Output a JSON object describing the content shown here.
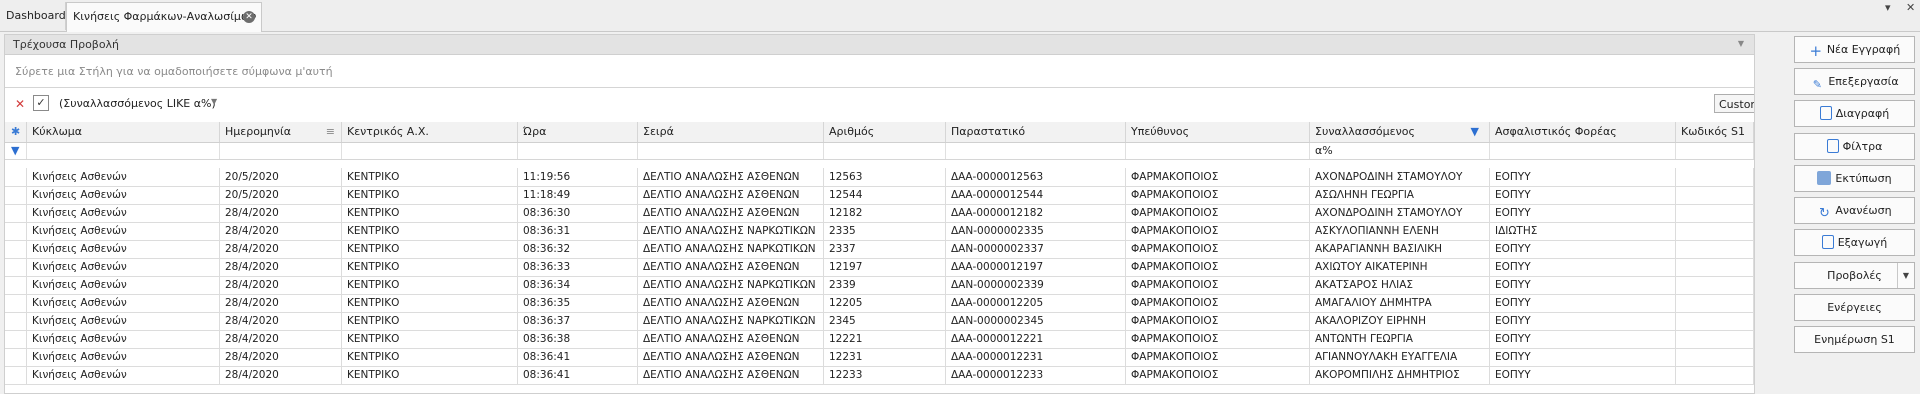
{
  "tabs": [
    {
      "label": "Dashboard"
    },
    {
      "label": "Κινήσεις Φαρμάκων-Αναλωσίμων"
    }
  ],
  "view_header": "Τρέχουσα Προβολή",
  "group_placeholder": "Σύρετε μια Στήλη για να ομαδοποιήσετε σύμφωνα μ'αυτή",
  "filter": {
    "text": "(Συναλλασσόμενος LIKE α%)",
    "checked": "✓",
    "customize_label": "Customize..."
  },
  "columns": [
    "Κύκλωμα",
    "Ημερομηνία",
    "Κεντρικός Α.Χ.",
    "Ώρα",
    "Σειρά",
    "Αριθμός",
    "Παραστατικό",
    "Υπεύθυνος",
    "Συναλλασσόμενος",
    "Ασφαλιστικός Φορέας",
    "Κωδικός S1"
  ],
  "filter_row_value": "α%",
  "rows": [
    [
      "Κινήσεις Ασθενών",
      "20/5/2020",
      "ΚΕΝΤΡΙΚΟ",
      "11:19:56",
      "ΔΕΛΤΙΟ ΑΝΑΛΩΣΗΣ ΑΣΘΕΝΩΝ",
      "12563",
      "ΔΑΑ-0000012563",
      "ΦΑΡΜΑΚΟΠΟΙΟΣ",
      "ΑΧΟΝΔΡΟΔΙΝΗ ΣΤΑΜΟΥΛΟΥ",
      "ΕΟΠΥΥ",
      ""
    ],
    [
      "Κινήσεις Ασθενών",
      "20/5/2020",
      "ΚΕΝΤΡΙΚΟ",
      "11:18:49",
      "ΔΕΛΤΙΟ ΑΝΑΛΩΣΗΣ ΑΣΘΕΝΩΝ",
      "12544",
      "ΔΑΑ-0000012544",
      "ΦΑΡΜΑΚΟΠΟΙΟΣ",
      "ΑΣΩΛΗΝΗ ΓΕΩΡΓΙΑ",
      "ΕΟΠΥΥ",
      ""
    ],
    [
      "Κινήσεις Ασθενών",
      "28/4/2020",
      "ΚΕΝΤΡΙΚΟ",
      "08:36:30",
      "ΔΕΛΤΙΟ ΑΝΑΛΩΣΗΣ ΑΣΘΕΝΩΝ",
      "12182",
      "ΔΑΑ-0000012182",
      "ΦΑΡΜΑΚΟΠΟΙΟΣ",
      "ΑΧΟΝΔΡΟΔΙΝΗ ΣΤΑΜΟΥΛΟΥ",
      "ΕΟΠΥΥ",
      ""
    ],
    [
      "Κινήσεις Ασθενών",
      "28/4/2020",
      "ΚΕΝΤΡΙΚΟ",
      "08:36:31",
      "ΔΕΛΤΙΟ ΑΝΑΛΩΣΗΣ ΝΑΡΚΩΤΙΚΩΝ",
      "2335",
      "ΔΑΝ-0000002335",
      "ΦΑΡΜΑΚΟΠΟΙΟΣ",
      "ΑΣΚΥΛΟΠΙΑΝΝΗ ΕΛΕΝΗ",
      "ΙΔΙΩΤΗΣ",
      ""
    ],
    [
      "Κινήσεις Ασθενών",
      "28/4/2020",
      "ΚΕΝΤΡΙΚΟ",
      "08:36:32",
      "ΔΕΛΤΙΟ ΑΝΑΛΩΣΗΣ ΝΑΡΚΩΤΙΚΩΝ",
      "2337",
      "ΔΑΝ-0000002337",
      "ΦΑΡΜΑΚΟΠΟΙΟΣ",
      "ΑΚΑΡΑΓΙΑΝΝΗ ΒΑΣΙΛΙΚΗ",
      "ΕΟΠΥΥ",
      ""
    ],
    [
      "Κινήσεις Ασθενών",
      "28/4/2020",
      "ΚΕΝΤΡΙΚΟ",
      "08:36:33",
      "ΔΕΛΤΙΟ ΑΝΑΛΩΣΗΣ ΑΣΘΕΝΩΝ",
      "12197",
      "ΔΑΑ-0000012197",
      "ΦΑΡΜΑΚΟΠΟΙΟΣ",
      "ΑΧΙΩΤΟΥ ΑΙΚΑΤΕΡΙΝΗ",
      "ΕΟΠΥΥ",
      ""
    ],
    [
      "Κινήσεις Ασθενών",
      "28/4/2020",
      "ΚΕΝΤΡΙΚΟ",
      "08:36:34",
      "ΔΕΛΤΙΟ ΑΝΑΛΩΣΗΣ ΝΑΡΚΩΤΙΚΩΝ",
      "2339",
      "ΔΑΝ-0000002339",
      "ΦΑΡΜΑΚΟΠΟΙΟΣ",
      "ΑΚΑΤΣΑΡΟΣ ΗΛΙΑΣ",
      "ΕΟΠΥΥ",
      ""
    ],
    [
      "Κινήσεις Ασθενών",
      "28/4/2020",
      "ΚΕΝΤΡΙΚΟ",
      "08:36:35",
      "ΔΕΛΤΙΟ ΑΝΑΛΩΣΗΣ ΑΣΘΕΝΩΝ",
      "12205",
      "ΔΑΑ-0000012205",
      "ΦΑΡΜΑΚΟΠΟΙΟΣ",
      "ΑΜΑΓΑΛΙΟΥ ΔΗΜΗΤΡΑ",
      "ΕΟΠΥΥ",
      ""
    ],
    [
      "Κινήσεις Ασθενών",
      "28/4/2020",
      "ΚΕΝΤΡΙΚΟ",
      "08:36:37",
      "ΔΕΛΤΙΟ ΑΝΑΛΩΣΗΣ ΝΑΡΚΩΤΙΚΩΝ",
      "2345",
      "ΔΑΝ-0000002345",
      "ΦΑΡΜΑΚΟΠΟΙΟΣ",
      "ΑΚΑΛΟΡΙΖΟΥ ΕΙΡΗΝΗ",
      "ΕΟΠΥΥ",
      ""
    ],
    [
      "Κινήσεις Ασθενών",
      "28/4/2020",
      "ΚΕΝΤΡΙΚΟ",
      "08:36:38",
      "ΔΕΛΤΙΟ ΑΝΑΛΩΣΗΣ ΑΣΘΕΝΩΝ",
      "12221",
      "ΔΑΑ-0000012221",
      "ΦΑΡΜΑΚΟΠΟΙΟΣ",
      "ΑΝΤΩΝΤΗ ΓΕΩΡΓΙΑ",
      "ΕΟΠΥΥ",
      ""
    ],
    [
      "Κινήσεις Ασθενών",
      "28/4/2020",
      "ΚΕΝΤΡΙΚΟ",
      "08:36:41",
      "ΔΕΛΤΙΟ ΑΝΑΛΩΣΗΣ ΑΣΘΕΝΩΝ",
      "12231",
      "ΔΑΑ-0000012231",
      "ΦΑΡΜΑΚΟΠΟΙΟΣ",
      "ΑΓΙΑΝΝΟΥΛΑΚΗ ΕΥΑΓΓΕΛΙΑ",
      "ΕΟΠΥΥ",
      ""
    ],
    [
      "Κινήσεις Ασθενών",
      "28/4/2020",
      "ΚΕΝΤΡΙΚΟ",
      "08:36:41",
      "ΔΕΛΤΙΟ ΑΝΑΛΩΣΗΣ ΑΣΘΕΝΩΝ",
      "12233",
      "ΔΑΑ-0000012233",
      "ΦΑΡΜΑΚΟΠΟΙΟΣ",
      "ΑΚΟΡΟΜΠΙΛΗΣ ΔΗΜΗΤΡΙΟΣ",
      "ΕΟΠΥΥ",
      ""
    ]
  ],
  "side_buttons": [
    {
      "label": "Νέα Εγγραφή",
      "icon": "plus-icon"
    },
    {
      "label": "Επεξεργασία",
      "icon": "pencil-icon"
    },
    {
      "label": "Διαγραφή",
      "icon": "trash-icon"
    },
    {
      "label": "Φίλτρα",
      "icon": "filter-doc-icon"
    },
    {
      "label": "Εκτύπωση",
      "icon": "printer-icon"
    },
    {
      "label": "Ανανέωση",
      "icon": "refresh-icon"
    },
    {
      "label": "Εξαγωγή",
      "icon": "export-icon"
    },
    {
      "label": "Προβολές",
      "icon": ""
    },
    {
      "label": "Ενέργειες",
      "icon": ""
    },
    {
      "label": "Ενημέρωση S1",
      "icon": ""
    }
  ],
  "colors": {
    "accent": "#3a7bd5",
    "filter_icon": "#2d6fd1",
    "close_x": "#d23a3a"
  }
}
